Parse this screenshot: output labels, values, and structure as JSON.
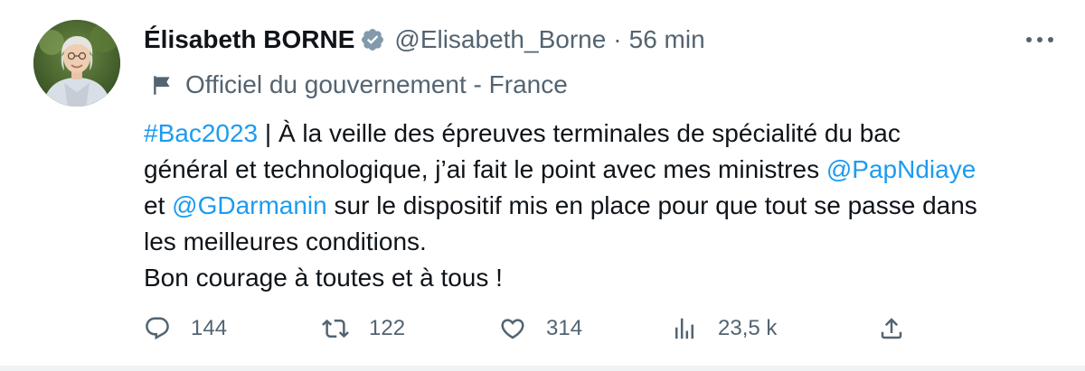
{
  "author": {
    "display_name": "Élisabeth BORNE",
    "handle": "@Elisabeth_Borne",
    "separator": "·",
    "time": "56 min"
  },
  "label": {
    "text": "Officiel du gouvernement - France",
    "icon": "flag-icon"
  },
  "tweet": {
    "lines": [
      [
        {
          "text": "#Bac2023",
          "type": "link"
        },
        {
          "text": " | À la veille des épreuves terminales de spécialité du bac",
          "type": "text"
        }
      ],
      [
        {
          "text": "général et technologique, j’ai fait le point avec mes ministres ",
          "type": "text"
        },
        {
          "text": "@PapNdiaye",
          "type": "link"
        }
      ],
      [
        {
          "text": "et ",
          "type": "text"
        },
        {
          "text": "@GDarmanin",
          "type": "link"
        },
        {
          "text": " sur le dispositif mis en place pour que tout se passe dans",
          "type": "text"
        }
      ],
      [
        {
          "text": "les meilleures conditions.",
          "type": "text"
        }
      ],
      [
        {
          "text": "Bon courage à toutes et à tous !",
          "type": "text"
        }
      ]
    ]
  },
  "actions": {
    "replies": "144",
    "retweets": "122",
    "likes": "314",
    "views": "23,5 k"
  },
  "colors": {
    "link": "#1d9bf0",
    "secondary_text": "#536471",
    "primary_text": "#0f1419",
    "verified_badge": "#829aab"
  },
  "icons": [
    "verified-icon",
    "more-icon",
    "flag-icon",
    "reply-icon",
    "retweet-icon",
    "like-icon",
    "views-icon",
    "share-icon"
  ]
}
